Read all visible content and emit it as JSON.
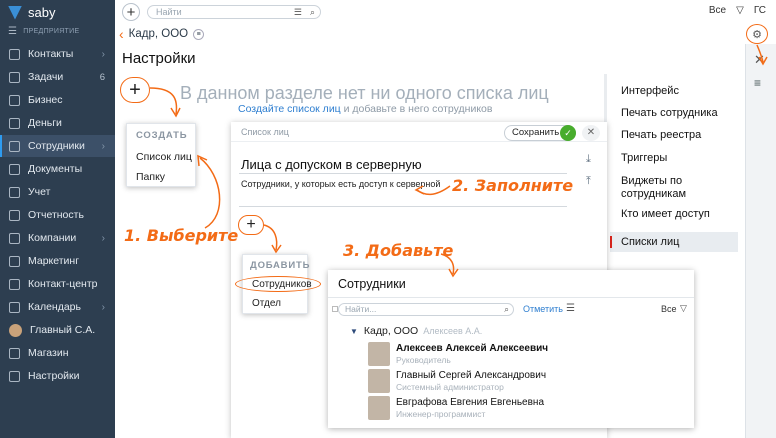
{
  "brand": {
    "name": "saby"
  },
  "sidebar": {
    "section": "ПРЕДПРИЯТИЕ",
    "items": [
      {
        "label": "Контакты",
        "icon": "contacts-icon",
        "chev": "›",
        "count": ""
      },
      {
        "label": "Задачи",
        "icon": "tasks-icon",
        "chev": "",
        "count": "6"
      },
      {
        "label": "Бизнес",
        "icon": "business-icon",
        "chev": "",
        "count": ""
      },
      {
        "label": "Деньги",
        "icon": "money-icon",
        "chev": "",
        "count": ""
      },
      {
        "label": "Сотрудники",
        "icon": "employees-icon",
        "chev": "›",
        "count": ""
      },
      {
        "label": "Документы",
        "icon": "documents-icon",
        "chev": "",
        "count": ""
      },
      {
        "label": "Учет",
        "icon": "accounting-icon",
        "chev": "",
        "count": ""
      },
      {
        "label": "Отчетность",
        "icon": "reports-icon",
        "chev": "",
        "count": ""
      },
      {
        "label": "Компании",
        "icon": "companies-icon",
        "chev": "›",
        "count": ""
      },
      {
        "label": "Маркетинг",
        "icon": "marketing-icon",
        "chev": "",
        "count": ""
      },
      {
        "label": "Контакт-центр",
        "icon": "contact-center-icon",
        "chev": "",
        "count": ""
      },
      {
        "label": "Календарь",
        "icon": "calendar-icon",
        "chev": "›",
        "count": ""
      },
      {
        "label": "Главный С.А.",
        "icon": "user-avatar",
        "chev": "",
        "count": ""
      },
      {
        "label": "Магазин",
        "icon": "store-icon",
        "chev": "",
        "count": ""
      },
      {
        "label": "Настройки",
        "icon": "settings-icon",
        "chev": "",
        "count": ""
      }
    ]
  },
  "topbar": {
    "search_placeholder": "Найти",
    "all_label": "Все",
    "user_initials": "ГС"
  },
  "breadcrumb": {
    "title": "Кадр, ООО"
  },
  "page": {
    "title": "Настройки"
  },
  "empty": {
    "title": "В данном разделе нет ни одного списка лиц",
    "link": "Создайте список лиц",
    "rest": " и добавьте в него сотрудников"
  },
  "create_menu": {
    "header": "СОЗДАТЬ",
    "items": [
      "Список лиц",
      "Папку"
    ]
  },
  "settings_nav": {
    "items": [
      "Интерфейс",
      "Печать сотрудника",
      "Печать реестра",
      "Триггеры",
      "Виджеты по сотрудникам",
      "Кто имеет доступ",
      "Списки лиц"
    ],
    "active_index": 6
  },
  "list_panel": {
    "label": "Список лиц",
    "save": "Сохранить",
    "name": "Лица с допуском в серверную",
    "description": "Сотрудники, у которых есть доступ к серверной"
  },
  "add_menu": {
    "header": "ДОБАВИТЬ",
    "items": [
      "Сотрудников",
      "Отдел"
    ]
  },
  "employees": {
    "title": "Сотрудники",
    "search_placeholder": "Найти...",
    "mark": "Отметить",
    "all": "Все",
    "org": "Кадр, ООО",
    "org_manager": "Алексеев А.А.",
    "people": [
      {
        "name": "Алексеев Алексей Алексеевич",
        "role": "Руководитель"
      },
      {
        "name": "Главный Сергей Александрович",
        "role": "Системный администратор"
      },
      {
        "name": "Евграфова Евгения Евгеньевна",
        "role": "Инженер-программист"
      }
    ]
  },
  "steps": {
    "s1": "1. Выберите",
    "s2": "2. Заполните",
    "s3": "3. Добавьте"
  },
  "colors": {
    "accent": "#f36b16",
    "sidebar": "#2d3e50",
    "link": "#2f7fd0",
    "ok": "#48ad2d"
  }
}
